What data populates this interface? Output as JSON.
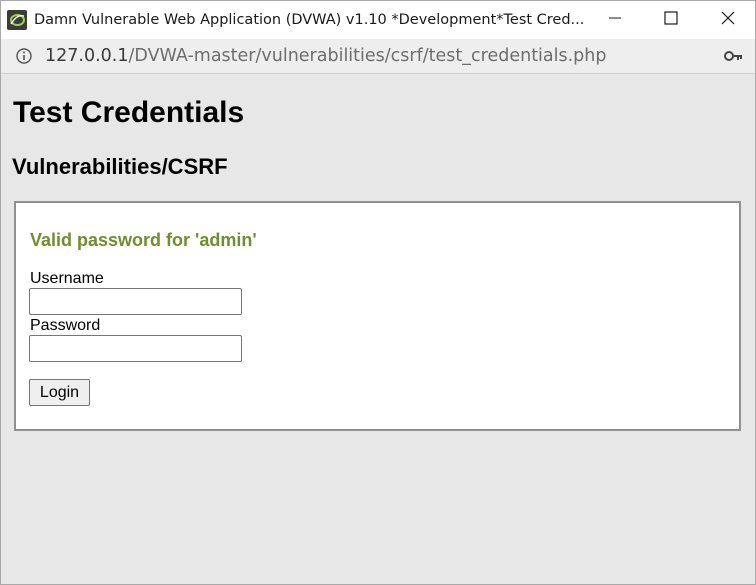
{
  "window": {
    "title": "Damn Vulnerable Web Application (DVWA) v1.10 *Development*Test Cred...",
    "app_icon": "dvwa-logo-icon",
    "controls": {
      "minimize_icon": "minimize-icon",
      "maximize_icon": "maximize-icon",
      "close_icon": "close-icon"
    }
  },
  "address_bar": {
    "info_icon": "info-icon",
    "url_host": "127.0.0.1",
    "url_path": "/DVWA-master/vulnerabilities/csrf/test_credentials.php",
    "key_icon": "key-icon"
  },
  "page": {
    "title": "Test Credentials",
    "subtitle": "Vulnerabilities/CSRF",
    "message": "Valid password for 'admin'",
    "message_color": "#6f8e2e",
    "form": {
      "username_label": "Username",
      "username_value": "",
      "password_label": "Password",
      "password_value": "",
      "login_label": "Login"
    }
  },
  "colors": {
    "page_background": "#e7e7e7",
    "panel_background": "#ffffff",
    "panel_border": "#8f8f8f"
  }
}
